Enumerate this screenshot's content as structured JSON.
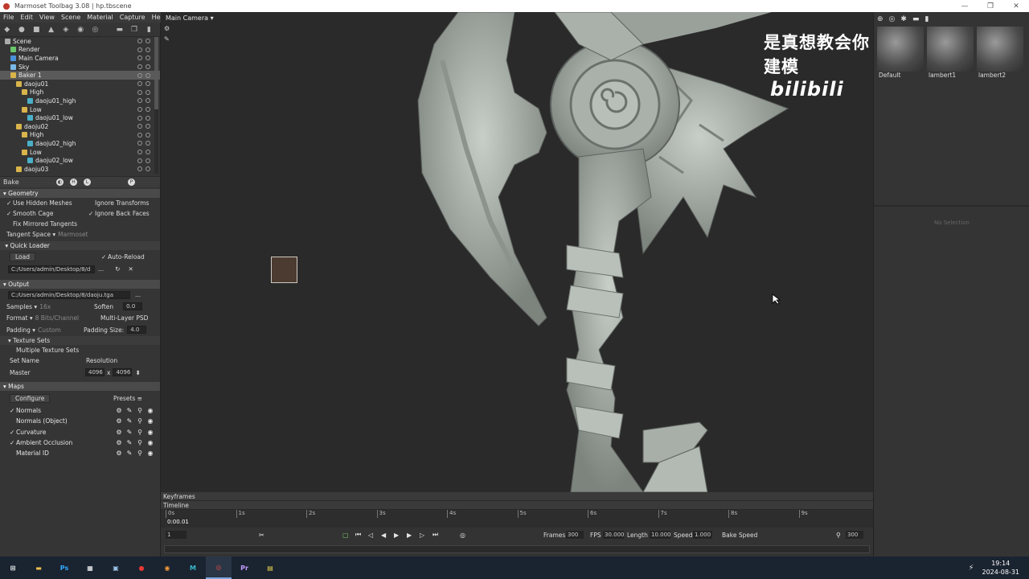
{
  "window": {
    "title": "Marmoset Toolbag 3.08  |  hp.tbscene",
    "controls": [
      "—",
      "❐",
      "✕"
    ]
  },
  "menu": [
    "File",
    "Edit",
    "View",
    "Scene",
    "Material",
    "Capture",
    "Help"
  ],
  "left_toolbar_icons": [
    "mesh-icon",
    "light-icon",
    "camera-icon",
    "sky-icon",
    "render-icon",
    "baker-icon",
    "globe-icon",
    "folder-icon",
    "duplicate-icon",
    "delete-icon"
  ],
  "tree": [
    {
      "label": "Scene",
      "icon": "scene",
      "indent": 0
    },
    {
      "label": "Render",
      "icon": "render",
      "indent": 1
    },
    {
      "label": "Main Camera",
      "icon": "cam",
      "indent": 1
    },
    {
      "label": "Sky",
      "icon": "sky",
      "indent": 1
    },
    {
      "label": "Baker 1",
      "icon": "baker",
      "indent": 1,
      "selected": true
    },
    {
      "label": "daoju01",
      "icon": "folder",
      "indent": 2
    },
    {
      "label": "High",
      "icon": "folder",
      "indent": 3
    },
    {
      "label": "daoju01_high",
      "icon": "mesh",
      "indent": 4
    },
    {
      "label": "Low",
      "icon": "folder",
      "indent": 3
    },
    {
      "label": "daoju01_low",
      "icon": "mesh",
      "indent": 4
    },
    {
      "label": "daoju02",
      "icon": "folder",
      "indent": 2
    },
    {
      "label": "High",
      "icon": "folder",
      "indent": 3
    },
    {
      "label": "daoju02_high",
      "icon": "mesh",
      "indent": 4
    },
    {
      "label": "Low",
      "icon": "folder",
      "indent": 3
    },
    {
      "label": "daoju02_low",
      "icon": "mesh",
      "indent": 4
    },
    {
      "label": "daoju03",
      "icon": "folder",
      "indent": 2
    }
  ],
  "bake": {
    "label": "Bake",
    "geometry": {
      "title": "Geometry",
      "use_hidden_meshes": "Use Hidden Meshes",
      "ignore_transforms": "Ignore Transforms",
      "smooth_cage": "Smooth Cage",
      "ignore_back_faces": "Ignore Back Faces",
      "fix_mirrored": "Fix Mirrored Tangents",
      "tangent_space_label": "Tangent Space",
      "tangent_space_value": "Marmoset"
    },
    "quick_loader": {
      "title": "Quick Loader",
      "load": "Load",
      "auto_reload": "Auto-Reload",
      "path": "C:/Users/admin/Desktop/8/d",
      "browse": "..."
    },
    "output": {
      "title": "Output",
      "path": "C:/Users/admin/Desktop/8/daoju.tga",
      "browse": "...",
      "samples_label": "Samples",
      "samples_value": "16x",
      "soften_label": "Soften",
      "soften_value": "0.0",
      "format_label": "Format",
      "format_value": "8 Bits/Channel",
      "multilayer": "Multi-Layer PSD",
      "padding_label": "Padding",
      "padding_value": "Custom",
      "padding_size_label": "Padding Size:",
      "padding_size_value": "4.0"
    },
    "texture_sets": {
      "title": "Texture Sets",
      "multiple": "Multiple Texture Sets",
      "set_name": "Set Name",
      "resolution": "Resolution",
      "master": "Master",
      "res_w": "4096",
      "res_x": "x",
      "res_h": "4096"
    },
    "maps": {
      "title": "Maps",
      "configure": "Configure",
      "presets": "Presets",
      "items": [
        {
          "label": "Normals",
          "checked": true
        },
        {
          "label": "Normals (Object)",
          "checked": false
        },
        {
          "label": "Curvature",
          "checked": true
        },
        {
          "label": "Ambient Occlusion",
          "checked": true
        },
        {
          "label": "Material ID",
          "checked": false
        }
      ]
    }
  },
  "viewport": {
    "camera_label": "Main Camera",
    "watermark_text": "是真想教会你建模",
    "watermark_logo": "bilibili"
  },
  "materials": {
    "items": [
      "Default",
      "lambert1",
      "lambert2"
    ],
    "no_selection": "No Selection"
  },
  "timeline": {
    "keyframes": "Keyframes",
    "timeline": "Timeline",
    "ticks": [
      "0s",
      "1s",
      "2s",
      "3s",
      "4s",
      "5s",
      "6s",
      "7s",
      "8s",
      "9s"
    ],
    "current_time": "0:00.01",
    "frame_field": "1",
    "frames_label": "Frames",
    "frames_value": "300",
    "fps_label": "FPS",
    "fps_value": "30.000",
    "length_label": "Length",
    "length_value": "10.000",
    "speed_label": "Speed",
    "speed_value": "1.000",
    "bake_speed": "Bake Speed",
    "end_frame": "300"
  },
  "taskbar": {
    "apps": [
      {
        "name": "start-icon",
        "glyph": "⊞",
        "color": "#ffffff"
      },
      {
        "name": "file-explorer-icon",
        "glyph": "▬",
        "color": "#f2c14e"
      },
      {
        "name": "photoshop-icon",
        "glyph": "Ps",
        "color": "#31a8ff"
      },
      {
        "name": "task-view-icon",
        "glyph": "▦",
        "color": "#ffffff"
      },
      {
        "name": "window-icon",
        "glyph": "▣",
        "color": "#9cc4e8"
      },
      {
        "name": "recorder-icon",
        "glyph": "●",
        "color": "#e53935"
      },
      {
        "name": "browser-icon",
        "glyph": "◉",
        "color": "#f29a3a"
      },
      {
        "name": "maya-icon",
        "glyph": "M",
        "color": "#37b8c9"
      },
      {
        "name": "marmoset-icon",
        "glyph": "◎",
        "color": "#d84a4a"
      },
      {
        "name": "premiere-icon",
        "glyph": "Pr",
        "color": "#c39bff"
      },
      {
        "name": "notes-icon",
        "glyph": "▤",
        "color": "#e8d44a"
      }
    ],
    "time": "19:14",
    "date": "2024-08-31"
  }
}
